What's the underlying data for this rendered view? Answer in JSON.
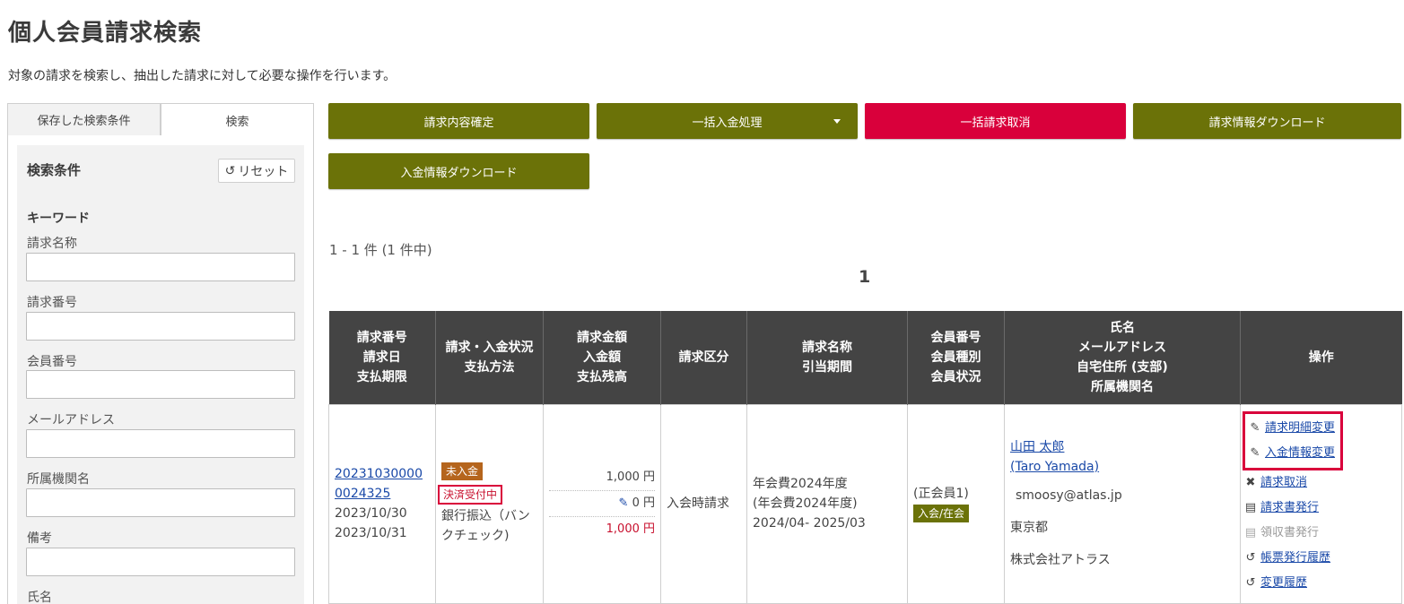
{
  "page": {
    "title": "個人会員請求検索",
    "description": "対象の請求を検索し、抽出した請求に対して必要な操作を行います。"
  },
  "left_panel": {
    "tabs": [
      {
        "label": "保存した検索条件"
      },
      {
        "label": "検索"
      }
    ],
    "heading": "検索条件",
    "reset_label": "リセット",
    "keyword_label": "キーワード",
    "fields": [
      {
        "label": "請求名称",
        "value": ""
      },
      {
        "label": "請求番号",
        "value": ""
      },
      {
        "label": "会員番号",
        "value": ""
      },
      {
        "label": "メールアドレス",
        "value": ""
      },
      {
        "label": "所属機関名",
        "value": ""
      },
      {
        "label": "備考",
        "value": ""
      }
    ],
    "partial_label": "氏名"
  },
  "actions": [
    {
      "label": "請求内容確定",
      "color": "#6b7208"
    },
    {
      "label": "一括入金処理",
      "color": "#6b7208"
    },
    {
      "label": "一括請求取消",
      "color": "#d9003b"
    },
    {
      "label": "請求情報ダウンロード",
      "color": "#6b7208"
    },
    {
      "label": "入金情報ダウンロード",
      "color": "#6b7208"
    }
  ],
  "results": {
    "count_text": "1 - 1 件 (1 件中)",
    "current_page": "1",
    "headers": [
      [
        "請求番号",
        "請求日",
        "支払期限"
      ],
      [
        "請求・入金状況",
        "支払方法"
      ],
      [
        "請求金額",
        "入金額",
        "支払残高"
      ],
      [
        "請求区分"
      ],
      [
        "請求名称",
        "引当期間"
      ],
      [
        "会員番号",
        "会員種別",
        "会員状況"
      ],
      [
        "氏名",
        "メールアドレス",
        "自宅住所 (支部)",
        "所属機関名"
      ],
      [
        "操作"
      ]
    ],
    "row": {
      "invoice_no_line1": "20231030000",
      "invoice_no_line2": "0024325",
      "invoice_date": "2023/10/30",
      "due_date": "2023/10/31",
      "payment_badge": "未入金",
      "settlement_badge": "決済受付中",
      "payment_method": "銀行振込（バンクチェック)",
      "amount_billed": "1,000 円",
      "amount_paid": "0 円",
      "amount_balance": "1,000 円",
      "category": "入会時請求",
      "name_line1": "年会費2024年度",
      "name_line2": "(年会費2024年度)",
      "period": "2024/04- 2025/03",
      "member_line": "(正会員1)",
      "member_status": "入会/在会",
      "person_name": "山田 太郎",
      "person_name_en": "(Taro Yamada)",
      "email": "smoosy@atlas.jp",
      "address": "東京都",
      "organization": "株式会社アトラス",
      "ops": [
        {
          "label": "請求明細変更",
          "icon": "pencil-icon"
        },
        {
          "label": "入金情報変更",
          "icon": "pencil-icon"
        },
        {
          "label": "請求取消",
          "icon": "x-icon"
        },
        {
          "label": "請求書発行",
          "icon": "document-icon"
        },
        {
          "label": "領収書発行",
          "icon": "document-icon"
        },
        {
          "label": "帳票発行履歴",
          "icon": "history-icon"
        },
        {
          "label": "変更履歴",
          "icon": "history-icon"
        }
      ]
    }
  }
}
